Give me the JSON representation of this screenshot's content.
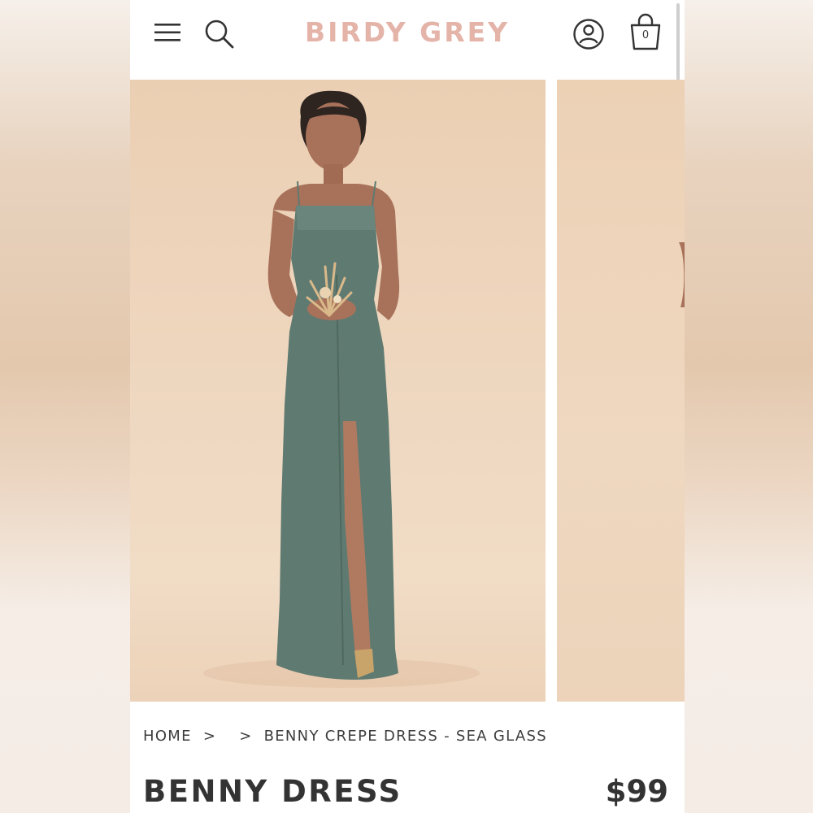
{
  "header": {
    "brand": "BIRDY GREY",
    "cart_count": "0",
    "icons": [
      "menu-icon",
      "search-icon",
      "account-icon",
      "bag-icon"
    ]
  },
  "gallery": {
    "main_image_alt": "Model wearing Benny crepe dress in sea glass",
    "next_image_alt": "Next product image"
  },
  "breadcrumb": {
    "home": "HOME",
    "separator": ">",
    "current": "BENNY CREPE DRESS - SEA GLASS"
  },
  "product": {
    "title": "BENNY DRESS",
    "price": "$99"
  },
  "colors": {
    "brand": "#e4b4a9",
    "dress": "#5f7a71",
    "backdrop": "#efd8c1"
  }
}
